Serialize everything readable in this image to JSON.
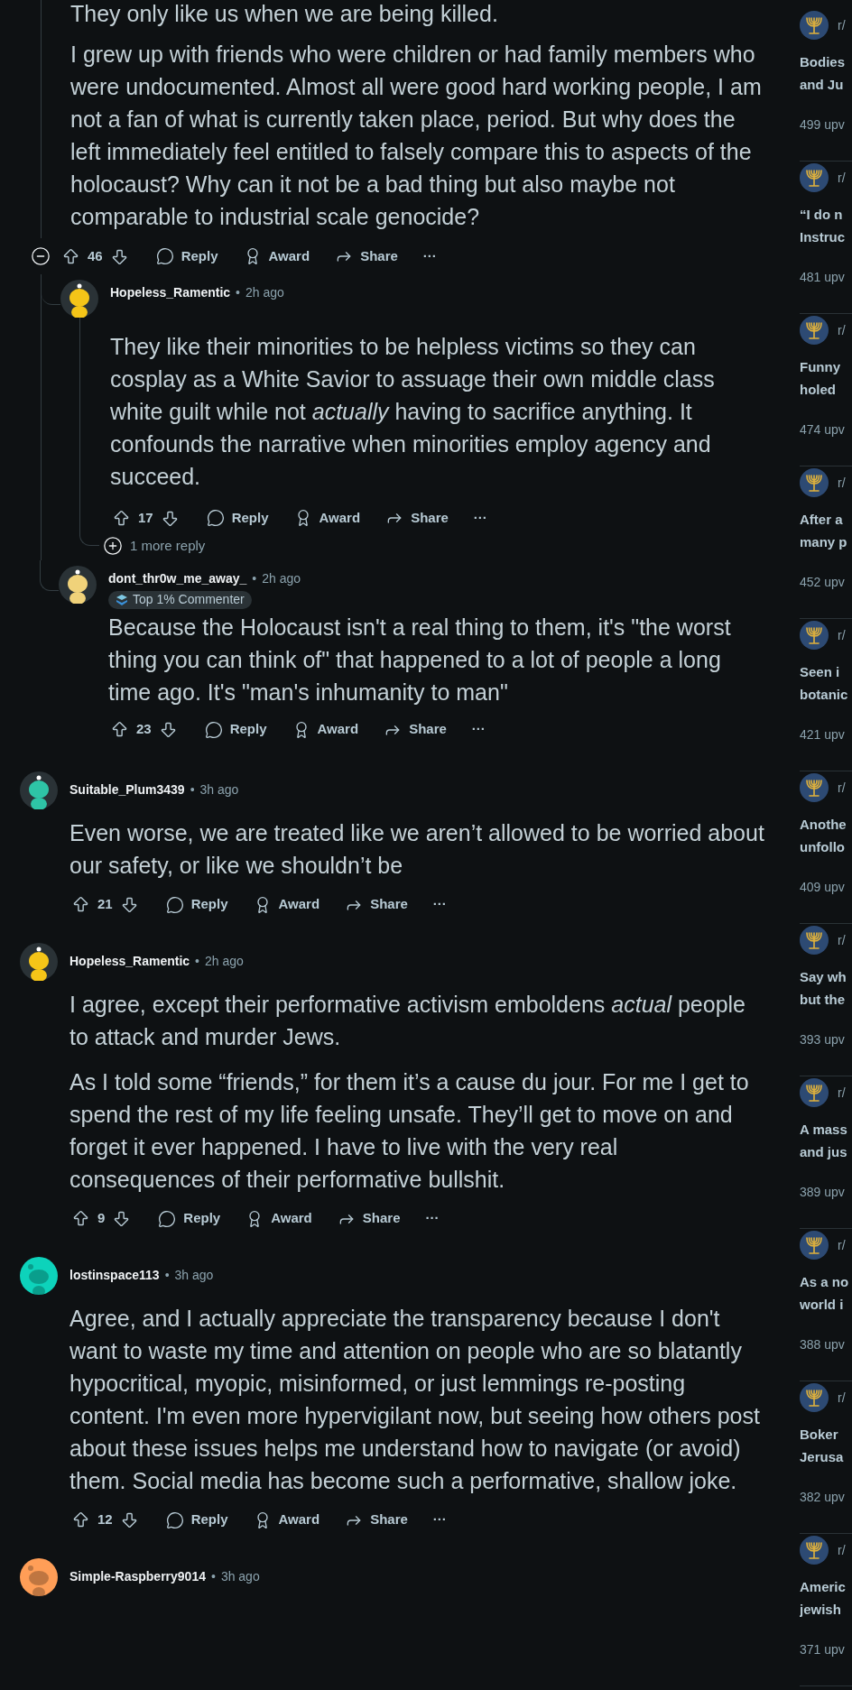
{
  "thread": {
    "cut_text": "They only like us when we are being killed.",
    "body": [
      "I grew up with friends who were children or had family members who were undocumented. Almost all were good hard working people, I am not a fan of what is currently taken place, period. But why does the left immediately feel entitled to falsely compare this to aspects of the holocaust? Why can it not be a bad thing but also maybe not comparable to industrial scale genocide?"
    ],
    "expanded": true,
    "votes": "46",
    "actions": [
      "Reply",
      "Award",
      "Share"
    ],
    "more": "···",
    "replies": [
      {
        "author": "Hopeless_Ramentic",
        "sep": "•",
        "time": "2h ago",
        "avatar": {
          "kind": "character",
          "color": "#f5c518"
        },
        "body": [
          "They like their minorities to be helpless victims so they can cosplay as a White Savior to assuage their own middle class white guilt while not *actually* having to sacrifice anything. It confounds the narrative when minorities employ agency and succeed."
        ],
        "votes": "17",
        "actions": [
          "Reply",
          "Award",
          "Share"
        ],
        "more": "···",
        "more_replies": "1 more reply"
      },
      {
        "author": "dont_thr0w_me_away_",
        "sep": "•",
        "time": "2h ago",
        "avatar": {
          "kind": "character",
          "color": "#f0d27a"
        },
        "badge": "Top 1% Commenter",
        "body": [
          "Because the Holocaust isn't a real thing to them, it's \"the worst thing you can think of\" that happened to a lot of people a long time ago. It's \"man's inhumanity to man\""
        ],
        "votes": "23",
        "actions": [
          "Reply",
          "Award",
          "Share"
        ],
        "more": "···"
      }
    ]
  },
  "comments": [
    {
      "author": "Suitable_Plum3439",
      "sep": "•",
      "time": "3h ago",
      "avatar": {
        "kind": "character",
        "color": "#2ec4a6"
      },
      "body": [
        "Even worse, we are treated like we aren’t allowed to be worried about our safety, or like we shouldn’t be"
      ],
      "votes": "21",
      "actions": [
        "Reply",
        "Award",
        "Share"
      ],
      "more": "···"
    },
    {
      "author": "Hopeless_Ramentic",
      "sep": "•",
      "time": "2h ago",
      "avatar": {
        "kind": "character",
        "color": "#f5c518"
      },
      "body": [
        "I agree, except their performative activism emboldens *actual* people to attack and murder Jews.",
        "As I told some “friends,” for them it’s a cause du jour. For me I get to spend the rest of my life feeling unsafe. They’ll get to move on and forget it ever happened. I have to live with the very real consequences of their performative bullshit."
      ],
      "votes": "9",
      "actions": [
        "Reply",
        "Award",
        "Share"
      ],
      "more": "···"
    },
    {
      "author": "lostinspace113",
      "sep": "•",
      "time": "3h ago",
      "avatar": {
        "kind": "snoo",
        "color": "#0dd3bb"
      },
      "body": [
        "Agree, and I actually appreciate the transparency because I don't want to waste my time and attention on people who are so blatantly hypocritical, myopic, misinformed, or just lemmings re-posting content. I'm even more hypervigilant now, but seeing how others post about these issues helps me understand how to navigate (or avoid) them. Social media has become such a performative, shallow joke."
      ],
      "votes": "12",
      "actions": [
        "Reply",
        "Award",
        "Share"
      ],
      "more": "···"
    },
    {
      "author": "Simple-Raspberry9014",
      "sep": "•",
      "time": "3h ago",
      "avatar": {
        "kind": "snoo",
        "color": "#ff9e57"
      }
    }
  ],
  "sidebar": {
    "posts": [
      {
        "community": "r/",
        "title": [
          "Bodies",
          "and Ju"
        ],
        "upvotes": "499 upv"
      },
      {
        "community": "r/",
        "title": [
          "“I do n",
          "Instruc"
        ],
        "upvotes": "481 upv"
      },
      {
        "community": "r/",
        "title": [
          "Funny",
          "holed"
        ],
        "upvotes": "474 upv"
      },
      {
        "community": "r/",
        "title": [
          "After a",
          "many p"
        ],
        "upvotes": "452 upv"
      },
      {
        "community": "r/",
        "title": [
          "Seen i",
          "botanic"
        ],
        "upvotes": "421 upv"
      },
      {
        "community": "r/",
        "title": [
          "Anothe",
          "unfollo"
        ],
        "upvotes": "409 upv"
      },
      {
        "community": "r/",
        "title": [
          "Say wh",
          "but the"
        ],
        "upvotes": "393 upv"
      },
      {
        "community": "r/",
        "title": [
          "A mass",
          "and jus"
        ],
        "upvotes": "389 upv"
      },
      {
        "community": "r/",
        "title": [
          "As a no",
          "world i"
        ],
        "upvotes": "388 upv"
      },
      {
        "community": "r/",
        "title": [
          "Boker",
          "Jerusa"
        ],
        "upvotes": "382 upv"
      },
      {
        "community": "r/",
        "title": [
          "Americ",
          "jewish"
        ],
        "upvotes": "371 upv"
      }
    ]
  }
}
